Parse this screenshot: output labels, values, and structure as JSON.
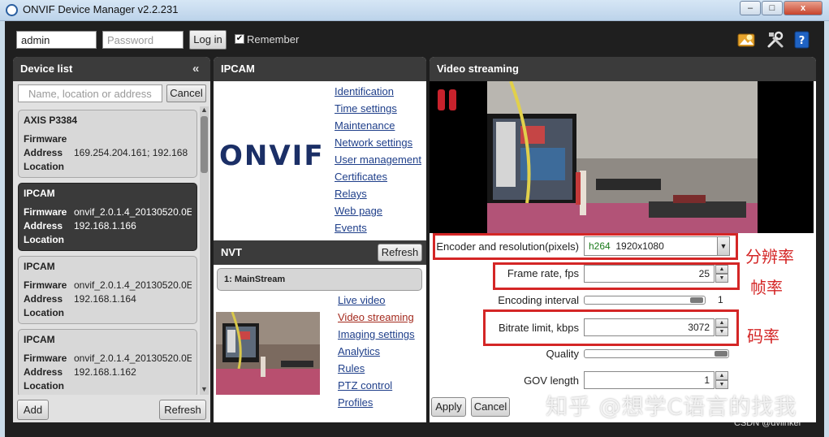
{
  "window": {
    "title": "ONVIF Device Manager v2.2.231",
    "minimize": "–",
    "maximize": "□",
    "close": "x"
  },
  "toolbar": {
    "login_value": "admin",
    "password_placeholder": "Password",
    "login_button": "Log in",
    "remember_label": "Remember",
    "remember_checked": "✔"
  },
  "device_list": {
    "title": "Device list",
    "collapse": "«",
    "search_placeholder": "Name, location or address",
    "cancel": "Cancel",
    "field_firmware": "Firmware",
    "field_address": "Address",
    "field_location": "Location",
    "devices": [
      {
        "name": "AXIS P3384",
        "firmware": "",
        "address": "169.254.204.161; 192.168",
        "location": ""
      },
      {
        "name": "IPCAM",
        "firmware": "onvif_2.0.1.4_20130520.0E",
        "address": "192.168.1.166",
        "location": ""
      },
      {
        "name": "IPCAM",
        "firmware": "onvif_2.0.1.4_20130520.0E",
        "address": "192.168.1.164",
        "location": ""
      },
      {
        "name": "IPCAM",
        "firmware": "onvif_2.0.1.4_20130520.0E",
        "address": "192.168.1.162",
        "location": ""
      }
    ],
    "selected_index": 1,
    "add": "Add",
    "refresh": "Refresh"
  },
  "ipcam": {
    "title": "IPCAM",
    "logo_text": "ONVIF",
    "links": [
      "Identification",
      "Time settings",
      "Maintenance",
      "Network settings",
      "User management",
      "Certificates",
      "Relays",
      "Web page",
      "Events"
    ]
  },
  "nvt": {
    "title": "NVT",
    "refresh": "Refresh",
    "stream": "1: MainStream",
    "links": [
      "Live video",
      "Video streaming",
      "Imaging settings",
      "Analytics",
      "Rules",
      "PTZ control",
      "Profiles"
    ]
  },
  "video_streaming": {
    "title": "Video streaming",
    "encoder_label": "Encoder and resolution(pixels)",
    "encoder_codec": "h264",
    "encoder_resolution": "1920x1080",
    "fps_label": "Frame rate, fps",
    "fps_value": "25",
    "interval_label": "Encoding interval",
    "interval_value": "1",
    "bitrate_label": "Bitrate limit, kbps",
    "bitrate_value": "3072",
    "quality_label": "Quality",
    "gov_label": "GOV length",
    "gov_value": "1",
    "apply": "Apply",
    "cancel": "Cancel"
  },
  "annotations": {
    "resolution_cn": "分辨率",
    "framerate_cn": "帧率",
    "bitrate_cn": "码率",
    "watermark": "知乎 @想学C语言的找我",
    "csdn": "CSDN @dvlinker"
  },
  "colors": {
    "accent_red": "#d42626",
    "link_blue": "#1f3f8a",
    "panel_header": "#3b3b3b"
  }
}
